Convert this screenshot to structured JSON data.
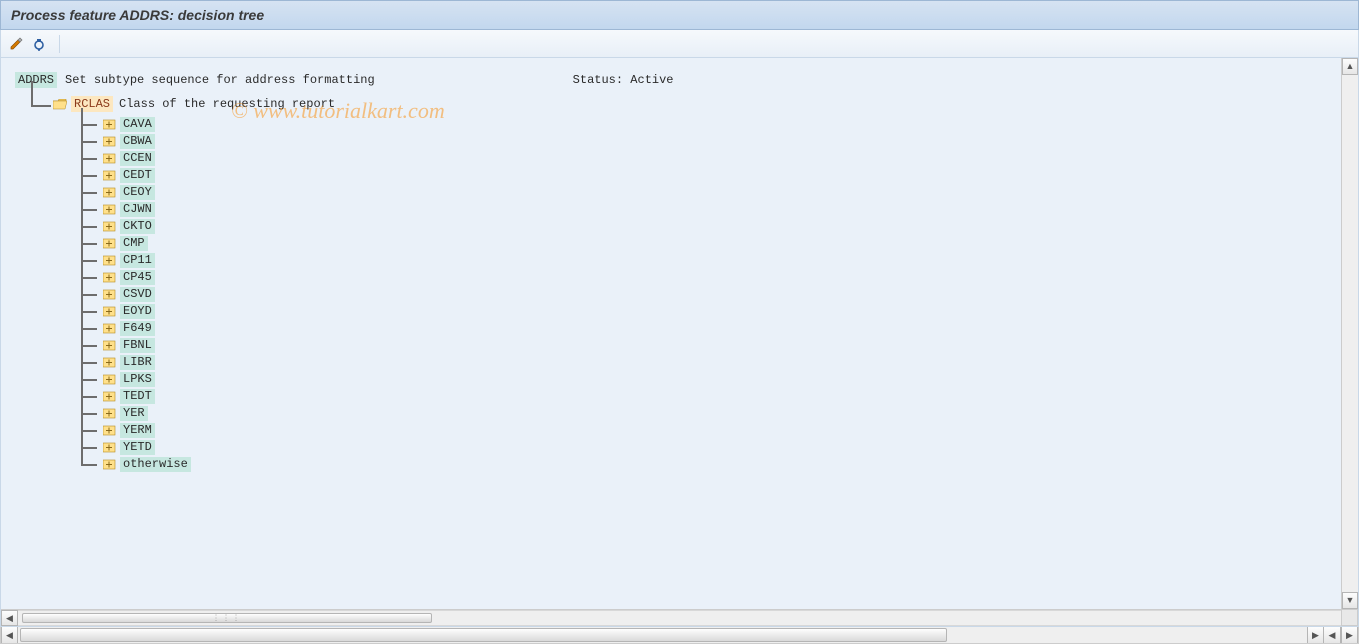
{
  "window_title": "Process feature ADDRS: decision tree",
  "watermark": "© www.tutorialkart.com",
  "header": {
    "feature_code": "ADDRS",
    "feature_desc": "Set subtype sequence for address formatting",
    "status_label": "Status:",
    "status_value": "Active"
  },
  "level1": {
    "code": "RCLAS",
    "desc": "Class of the requesting report"
  },
  "level2_items": [
    "CAVA",
    "CBWA",
    "CCEN",
    "CEDT",
    "CEOY",
    "CJWN",
    "CKTO",
    "CMP",
    "CP11",
    "CP45",
    "CSVD",
    "EOYD",
    "F649",
    "FBNL",
    "LIBR",
    "LPKS",
    "TEDT",
    "YER",
    "YERM",
    "YETD",
    "otherwise"
  ],
  "toolbar_icon_1": "change-icon",
  "toolbar_icon_2": "check-icon"
}
